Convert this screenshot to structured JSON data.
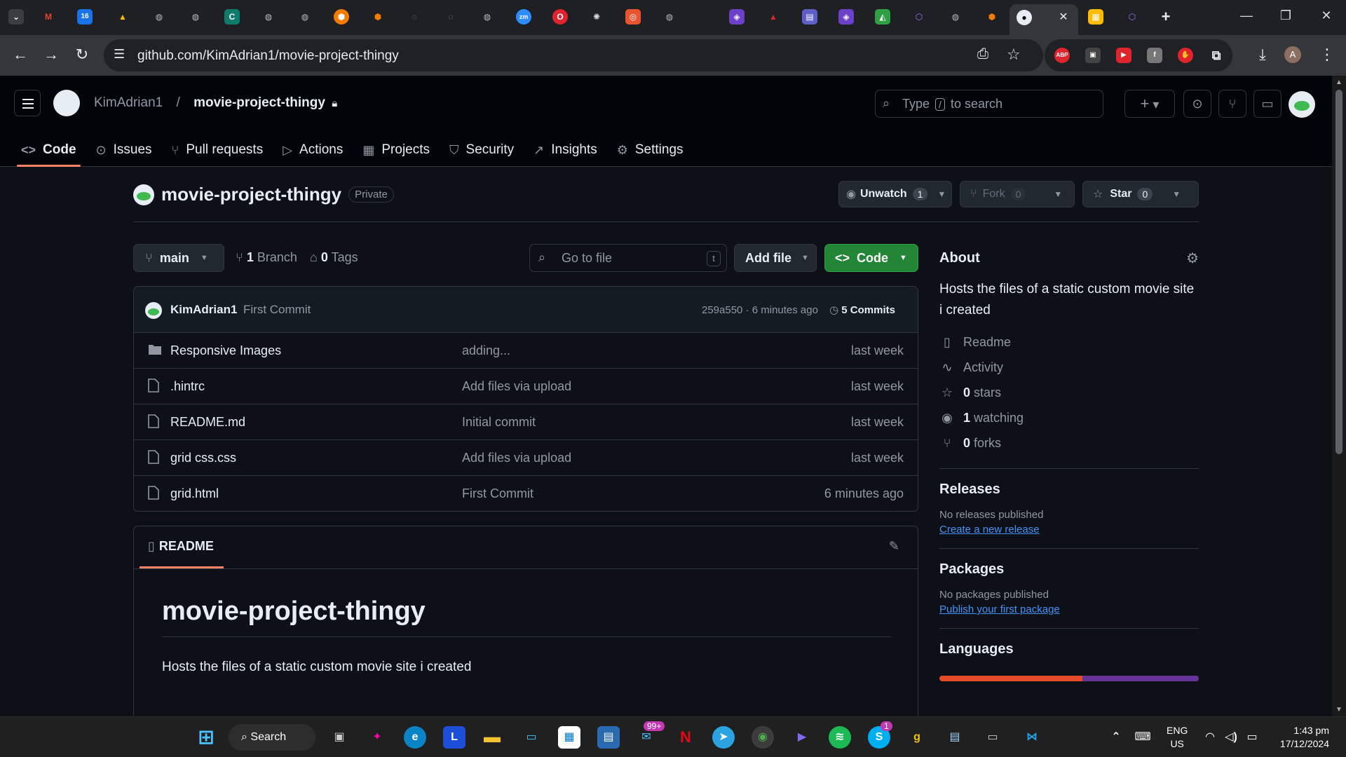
{
  "browser": {
    "url": "github.com/KimAdrian1/movie-project-thingy"
  },
  "header": {
    "owner": "KimAdrian1",
    "separator": "/",
    "repo": "movie-project-thingy",
    "search_prefix": "Type",
    "search_key": "/",
    "search_suffix": "to search",
    "plus": "+"
  },
  "repo_nav": [
    {
      "label": "Code",
      "icon": "code-icon",
      "active": true
    },
    {
      "label": "Issues",
      "icon": "issue-icon"
    },
    {
      "label": "Pull requests",
      "icon": "pull-request-icon"
    },
    {
      "label": "Actions",
      "icon": "play-icon"
    },
    {
      "label": "Projects",
      "icon": "table-icon"
    },
    {
      "label": "Security",
      "icon": "shield-icon"
    },
    {
      "label": "Insights",
      "icon": "graph-icon"
    },
    {
      "label": "Settings",
      "icon": "gear-icon"
    }
  ],
  "repo": {
    "name": "movie-project-thingy",
    "visibility": "Private",
    "unwatch": "Unwatch",
    "unwatch_count": "1",
    "fork": "Fork",
    "fork_count": "0",
    "star": "Star",
    "star_count": "0"
  },
  "toolbar": {
    "branch": "main",
    "branches_count": "1",
    "branches_label": "Branch",
    "tags_count": "0",
    "tags_label": "Tags",
    "go_to_file": "Go to file",
    "go_to_file_key": "t",
    "add_file": "Add file",
    "code": "Code"
  },
  "commit": {
    "author": "KimAdrian1",
    "message": "First Commit",
    "hash_time": "259a550 · 6 minutes ago",
    "commits_count": "5",
    "commits_label": "Commits"
  },
  "files": [
    {
      "name": "Responsive Images",
      "type": "folder",
      "message": "adding...",
      "date": "last week"
    },
    {
      "name": ".hintrc",
      "type": "file",
      "message": "Add files via upload",
      "date": "last week"
    },
    {
      "name": "README.md",
      "type": "file",
      "message": "Initial commit",
      "date": "last week"
    },
    {
      "name": "grid css.css",
      "type": "file",
      "message": "Add files via upload",
      "date": "last week"
    },
    {
      "name": "grid.html",
      "type": "file",
      "message": "First Commit",
      "date": "6 minutes ago"
    }
  ],
  "readme": {
    "tab": "README",
    "heading": "movie-project-thingy",
    "body": "Hosts the files of a static custom movie site i created"
  },
  "about": {
    "title": "About",
    "description": "Hosts the files of a static custom movie site i created",
    "readme": "Readme",
    "activity": "Activity",
    "stars_count": "0",
    "stars_label": "stars",
    "watching_count": "1",
    "watching_label": "watching",
    "forks_count": "0",
    "forks_label": "forks"
  },
  "releases": {
    "title": "Releases",
    "none": "No releases published",
    "link": "Create a new release"
  },
  "packages": {
    "title": "Packages",
    "none": "No packages published",
    "link": "Publish your first package"
  },
  "languages": {
    "title": "Languages"
  },
  "taskbar": {
    "search": "Search",
    "mail_badge": "99+",
    "skype_badge": "1",
    "lang": "ENG",
    "region": "US",
    "time": "1:43 pm",
    "date": "17/12/2024"
  },
  "colors": {
    "accent": "#f78166",
    "green": "#238636",
    "link": "#4493f8",
    "bg": "#0d1117"
  }
}
